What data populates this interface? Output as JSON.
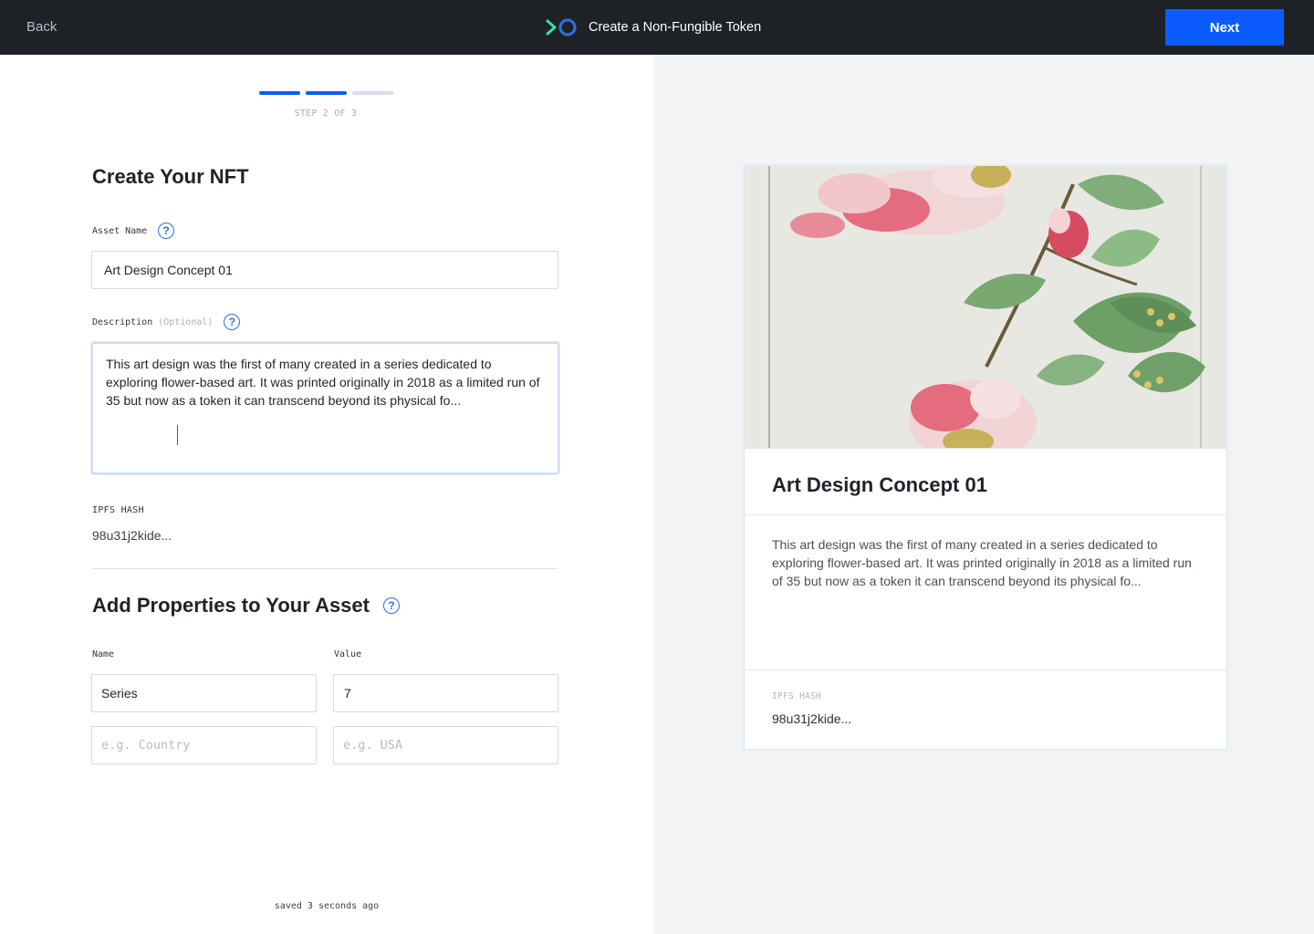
{
  "topbar": {
    "back_label": "Back",
    "title": "Create a Non-Fungible Token",
    "next_label": "Next",
    "logo_icon": "brand-logo-icon",
    "colors": {
      "bar": "#1e2126",
      "accent": "#0b5cff",
      "logo_chevron": "#2ee6a6",
      "logo_ring": "#2f6fe0"
    }
  },
  "steps": {
    "label": "STEP 2 OF 3",
    "current": 2,
    "total": 3
  },
  "form": {
    "heading": "Create Your NFT",
    "asset_name_label": "Asset Name",
    "asset_name_value": "Art Design Concept 01",
    "description_label": "Description",
    "description_optional": "(Optional)",
    "description_value": "This art design was the first of many created in a series dedicated to exploring flower-based art. It was printed originally in 2018 as a limited run of 35 but now as a token it can transcend beyond its physical fo...",
    "ipfs_label": "IPFS HASH",
    "ipfs_value": "98u31j2kide...",
    "help_glyph": "?"
  },
  "properties": {
    "heading": "Add Properties to Your Asset",
    "name_label": "Name",
    "value_label": "Value",
    "rows": [
      {
        "name": "Series",
        "value": "7"
      }
    ],
    "name_placeholder": "e.g. Country",
    "value_placeholder": "e.g. USA"
  },
  "status": {
    "saved": "saved 3 seconds ago"
  },
  "preview": {
    "title": "Art Design Concept 01",
    "description": "This art design was the first of many created in a series dedicated to exploring flower-based art. It was printed originally in 2018 as a limited run of 35 but now as a token it can transcend beyond its physical fo...",
    "ipfs_label": "IPFS HASH",
    "ipfs_value": "98u31j2kide...",
    "image_icon": "flower-artwork-image"
  }
}
